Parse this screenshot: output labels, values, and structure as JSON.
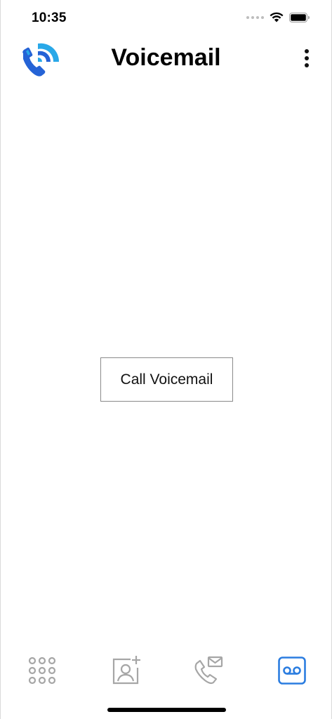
{
  "status_bar": {
    "time": "10:35"
  },
  "header": {
    "title": "Voicemail",
    "logo_icon": "phone-wifi-logo-icon",
    "menu_icon": "more-vertical-icon"
  },
  "main": {
    "call_voicemail_label": "Call Voicemail"
  },
  "tab_bar": {
    "items": [
      {
        "icon": "dialpad-icon",
        "active": false
      },
      {
        "icon": "add-contact-icon",
        "active": false
      },
      {
        "icon": "call-mail-icon",
        "active": false
      },
      {
        "icon": "voicemail-icon",
        "active": true
      }
    ]
  },
  "colors": {
    "accent": "#2b7de0",
    "logo_light": "#29a8e8",
    "logo_dark": "#2563d6",
    "inactive_icon": "#a6a6a6",
    "text": "#000000"
  }
}
